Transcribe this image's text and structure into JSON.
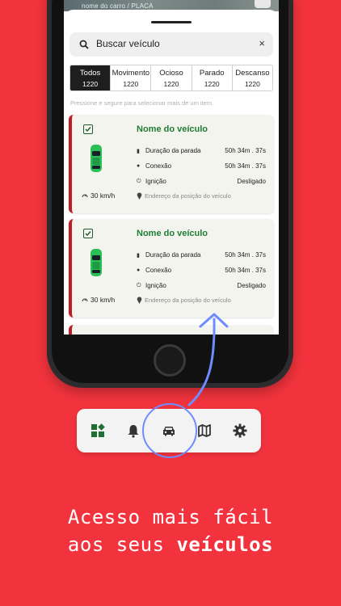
{
  "map": {
    "label": "nome do carro / PLACA"
  },
  "search": {
    "placeholder": "Buscar veículo",
    "clear": "×"
  },
  "tabs": [
    {
      "label": "Todos",
      "count": "1220",
      "active": true
    },
    {
      "label": "Movimento",
      "count": "1220",
      "active": false
    },
    {
      "label": "Ocioso",
      "count": "1220",
      "active": false
    },
    {
      "label": "Parado",
      "count": "1220",
      "active": false
    },
    {
      "label": "Descanso",
      "count": "1220",
      "active": false
    }
  ],
  "hint": "Pressione e segure para selecionar mais de um item.",
  "cards": [
    {
      "name": "Nome do veículo",
      "rows": [
        {
          "label": "Duração da parada",
          "value": "50h 34m . 37s"
        },
        {
          "label": "Conexão",
          "value": "50h 34m . 37s"
        },
        {
          "label": "Ignição",
          "value": "Desligado"
        }
      ],
      "speed": "30 km/h",
      "address": "Endereço da posição do veículo"
    },
    {
      "name": "Nome do veículo",
      "rows": [
        {
          "label": "Duração da parada",
          "value": "50h 34m . 37s"
        },
        {
          "label": "Conexão",
          "value": "50h 34m . 37s"
        },
        {
          "label": "Ignição",
          "value": "Desligado"
        }
      ],
      "speed": "30 km/h",
      "address": "Endereço da posição do veículo"
    }
  ],
  "nav": [
    {
      "icon": "dashboard-icon"
    },
    {
      "icon": "bell-icon"
    },
    {
      "icon": "car-icon",
      "active": true
    },
    {
      "icon": "map-icon"
    },
    {
      "icon": "gear-icon"
    }
  ],
  "caption": {
    "line1": "Acesso mais fácil",
    "line2_prefix": "aos seus ",
    "line2_bold": "veículos"
  },
  "colors": {
    "background": "#f2333d",
    "accent_green": "#1f7d34",
    "card_stripe": "#c01c28",
    "highlight": "#6f8cff"
  }
}
